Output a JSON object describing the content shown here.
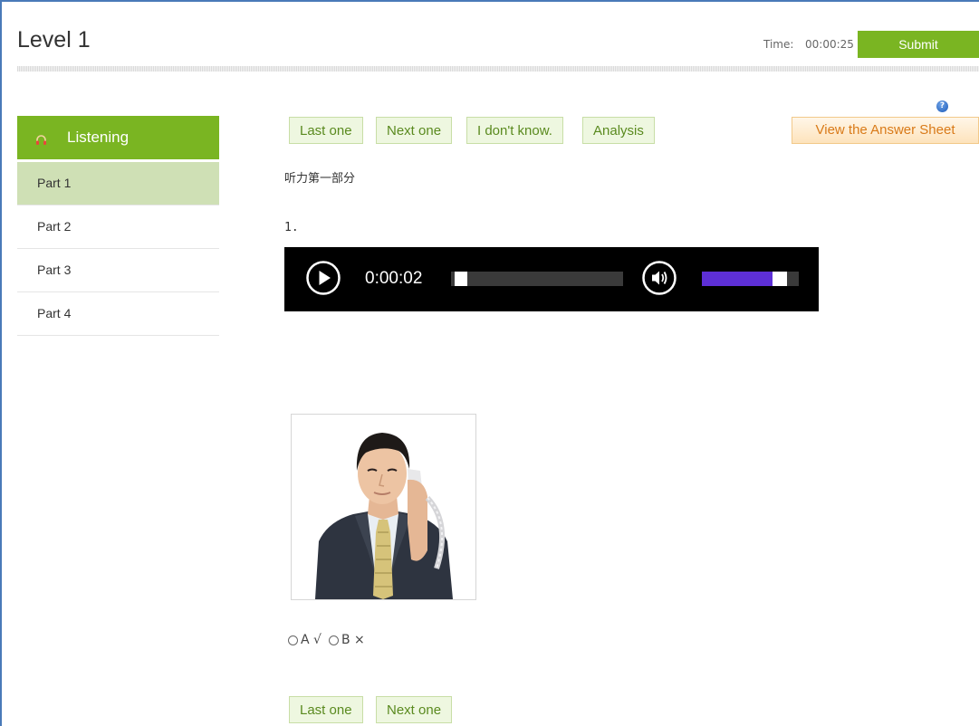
{
  "header": {
    "title": "Level 1",
    "timer_label": "Time:",
    "timer_value": "00:00:25",
    "submit_label": "Submit"
  },
  "sidebar": {
    "section_label": "Listening",
    "section_icon": "headphones-icon",
    "items": [
      {
        "label": "Part 1",
        "active": true
      },
      {
        "label": "Part 2",
        "active": false
      },
      {
        "label": "Part 3",
        "active": false
      },
      {
        "label": "Part 4",
        "active": false
      }
    ]
  },
  "toolbar": {
    "last_label": "Last one",
    "next_label": "Next one",
    "dont_know_label": "I don't know.",
    "analysis_label": "Analysis",
    "answer_sheet_label": "View the Answer Sheet",
    "help_icon": "question-mark-icon"
  },
  "question": {
    "section_title": "听力第一部分",
    "number": "1.",
    "options": [
      {
        "letter": "A",
        "mark": "√"
      },
      {
        "letter": "B",
        "mark": "×"
      }
    ]
  },
  "audio": {
    "time": "0:00:02",
    "progress": 0.02,
    "volume": 0.86
  },
  "footer_nav": {
    "last_label": "Last one",
    "next_label": "Next one"
  },
  "colors": {
    "accent_green": "#7ab522",
    "active_item_bg": "#cfe0b5",
    "answer_sheet_orange": "#d97a18",
    "volume_purple": "#5d2fd6"
  }
}
